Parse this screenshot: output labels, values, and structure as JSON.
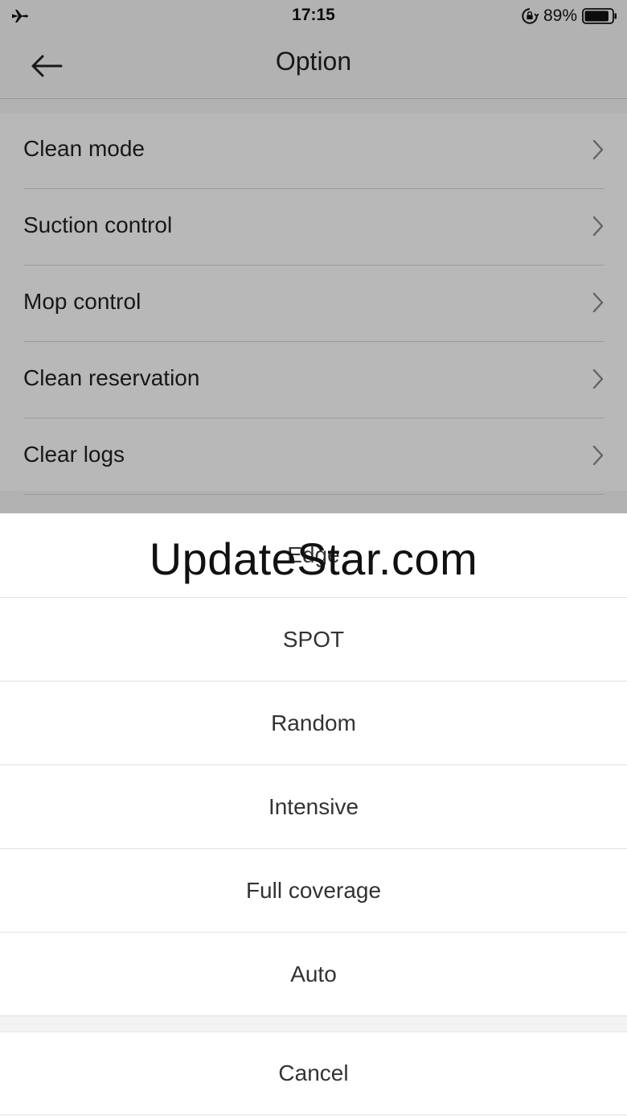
{
  "status_bar": {
    "time": "17:15",
    "battery_percent": "89%",
    "battery_level": 0.89,
    "icons": [
      "airplane-mode-icon",
      "rotation-lock-icon",
      "battery-icon"
    ]
  },
  "nav": {
    "title": "Option",
    "back_icon": "back-arrow-icon"
  },
  "settings": {
    "items": [
      {
        "label": "Clean mode"
      },
      {
        "label": "Suction control"
      },
      {
        "label": "Mop control"
      },
      {
        "label": "Clean reservation"
      },
      {
        "label": "Clear logs"
      }
    ],
    "chevron_icon": "chevron-right-icon"
  },
  "action_sheet": {
    "options": [
      {
        "label": "Edge"
      },
      {
        "label": "SPOT"
      },
      {
        "label": "Random"
      },
      {
        "label": "Intensive"
      },
      {
        "label": "Full coverage"
      },
      {
        "label": "Auto"
      }
    ],
    "cancel_label": "Cancel"
  },
  "watermark": {
    "text": "UpdateStar.com"
  }
}
